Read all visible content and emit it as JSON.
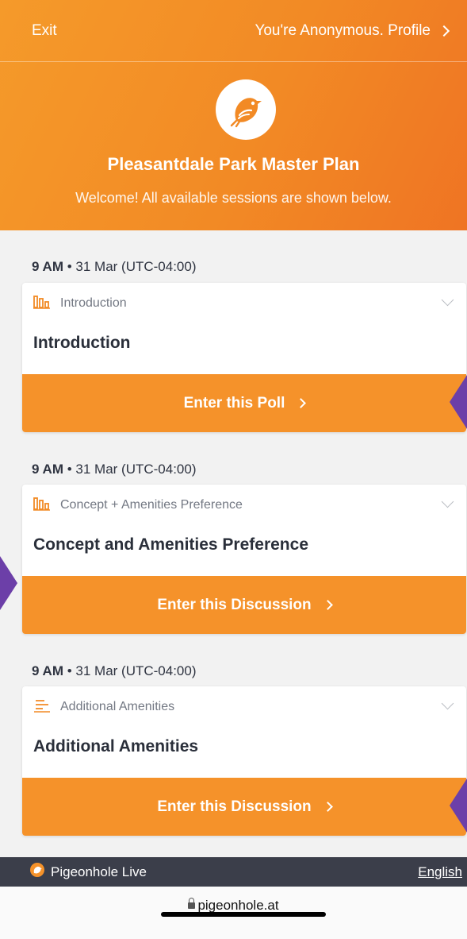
{
  "topbar": {
    "exit_label": "Exit",
    "profile_label": "You're Anonymous. Profile"
  },
  "event": {
    "title": "Pleasantdale Park Master Plan",
    "subtitle": "Welcome! All available sessions are shown below."
  },
  "sessions": [
    {
      "time_bold": "9 AM",
      "time_rest": " • 31 Mar (UTC-04:00)",
      "type_icon": "poll-bars-icon",
      "type_label": "Introduction",
      "title": "Introduction",
      "button_label": "Enter this Poll"
    },
    {
      "time_bold": "9 AM",
      "time_rest": " • 31 Mar (UTC-04:00)",
      "type_icon": "poll-bars-icon",
      "type_label": "Concept + Amenities Preference",
      "title": "Concept and Amenities Preference",
      "button_label": "Enter this Discussion"
    },
    {
      "time_bold": "9 AM",
      "time_rest": " • 31 Mar (UTC-04:00)",
      "type_icon": "discussion-lines-icon",
      "type_label": "Additional Amenities",
      "title": "Additional Amenities",
      "button_label": "Enter this Discussion"
    }
  ],
  "footer": {
    "brand": "Pigeonhole Live",
    "language": "English"
  },
  "browser": {
    "url": "pigeonhole.at"
  },
  "colors": {
    "accent": "#f5922a",
    "header_gradient_end": "#ef7423",
    "footer_bg": "#3b3e4a",
    "side_tab": "#6c3fa8"
  }
}
